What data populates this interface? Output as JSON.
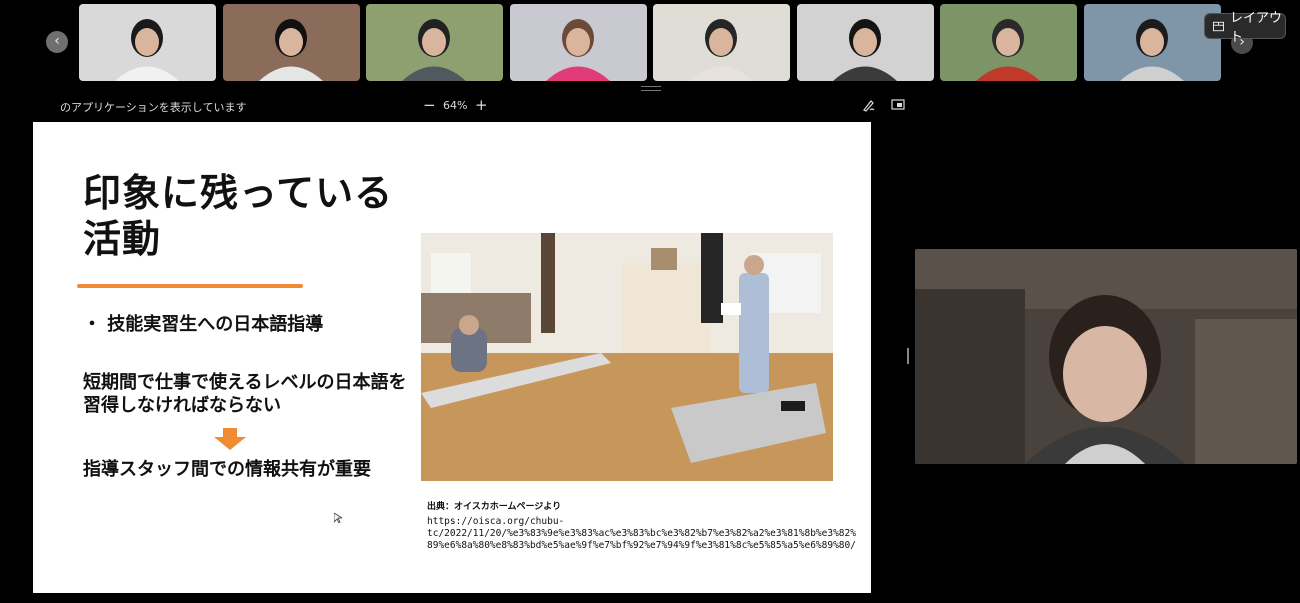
{
  "participant_strip": {
    "prev_icon": "chevron-left-icon",
    "next_icon": "chevron-right-icon",
    "tiles": [
      {
        "bg": "#d9d9d9",
        "shirt": "#f1f1f1",
        "hair": "#1a1a1a"
      },
      {
        "bg": "#8b6b5a",
        "shirt": "#e6e6e6",
        "hair": "#111111"
      },
      {
        "bg": "#8ea070",
        "shirt": "#505860",
        "hair": "#222222"
      },
      {
        "bg": "#c9c9d2",
        "shirt": "#e23b7a",
        "hair": "#6b4a3a"
      },
      {
        "bg": "#e0dcd6",
        "shirt": "#e7e2dc",
        "hair": "#262626"
      },
      {
        "bg": "#d2d2d2",
        "shirt": "#3b3b3b",
        "hair": "#141414"
      },
      {
        "bg": "#7d9466",
        "shirt": "#c03a2b",
        "hair": "#2a2a2a"
      },
      {
        "bg": "#7f95a8",
        "shirt": "#cfcfcf",
        "hair": "#1c1c1c"
      }
    ],
    "layout_label": "レイアウト"
  },
  "share_toolbar": {
    "sharing_text": "のアプリケーションを表示しています",
    "zoom_out": "−",
    "zoom_level": "64%",
    "zoom_in": "+"
  },
  "slide": {
    "title": "印象に残っている\n活動",
    "bullet": "・ 技能実習生への日本語指導",
    "body1": "短期間で仕事で使えるレベルの日本語を習得しなければならない",
    "body2": "指導スタッフ間での情報共有が重要",
    "source_label": "出典：オイスカホームページより",
    "source_url": "https://oisca.org/chubu-\ntc/2022/11/20/%e3%83%9e%e3%83%ac%e3%83%bc%e3%82%b7%e3%82%a2%e3%81%8b%e3%82%89%e6%8a%80%e8%83%bd%e5%ae%9f%e7%bf%92%e7%94%9f%e3%81%8c%e5%85%a5%e6%89%80/",
    "accent_color": "#f08a33"
  },
  "speaker": {
    "bg": "#4a423c",
    "shirt": "#3a3a3a",
    "hair": "#2b211c"
  }
}
